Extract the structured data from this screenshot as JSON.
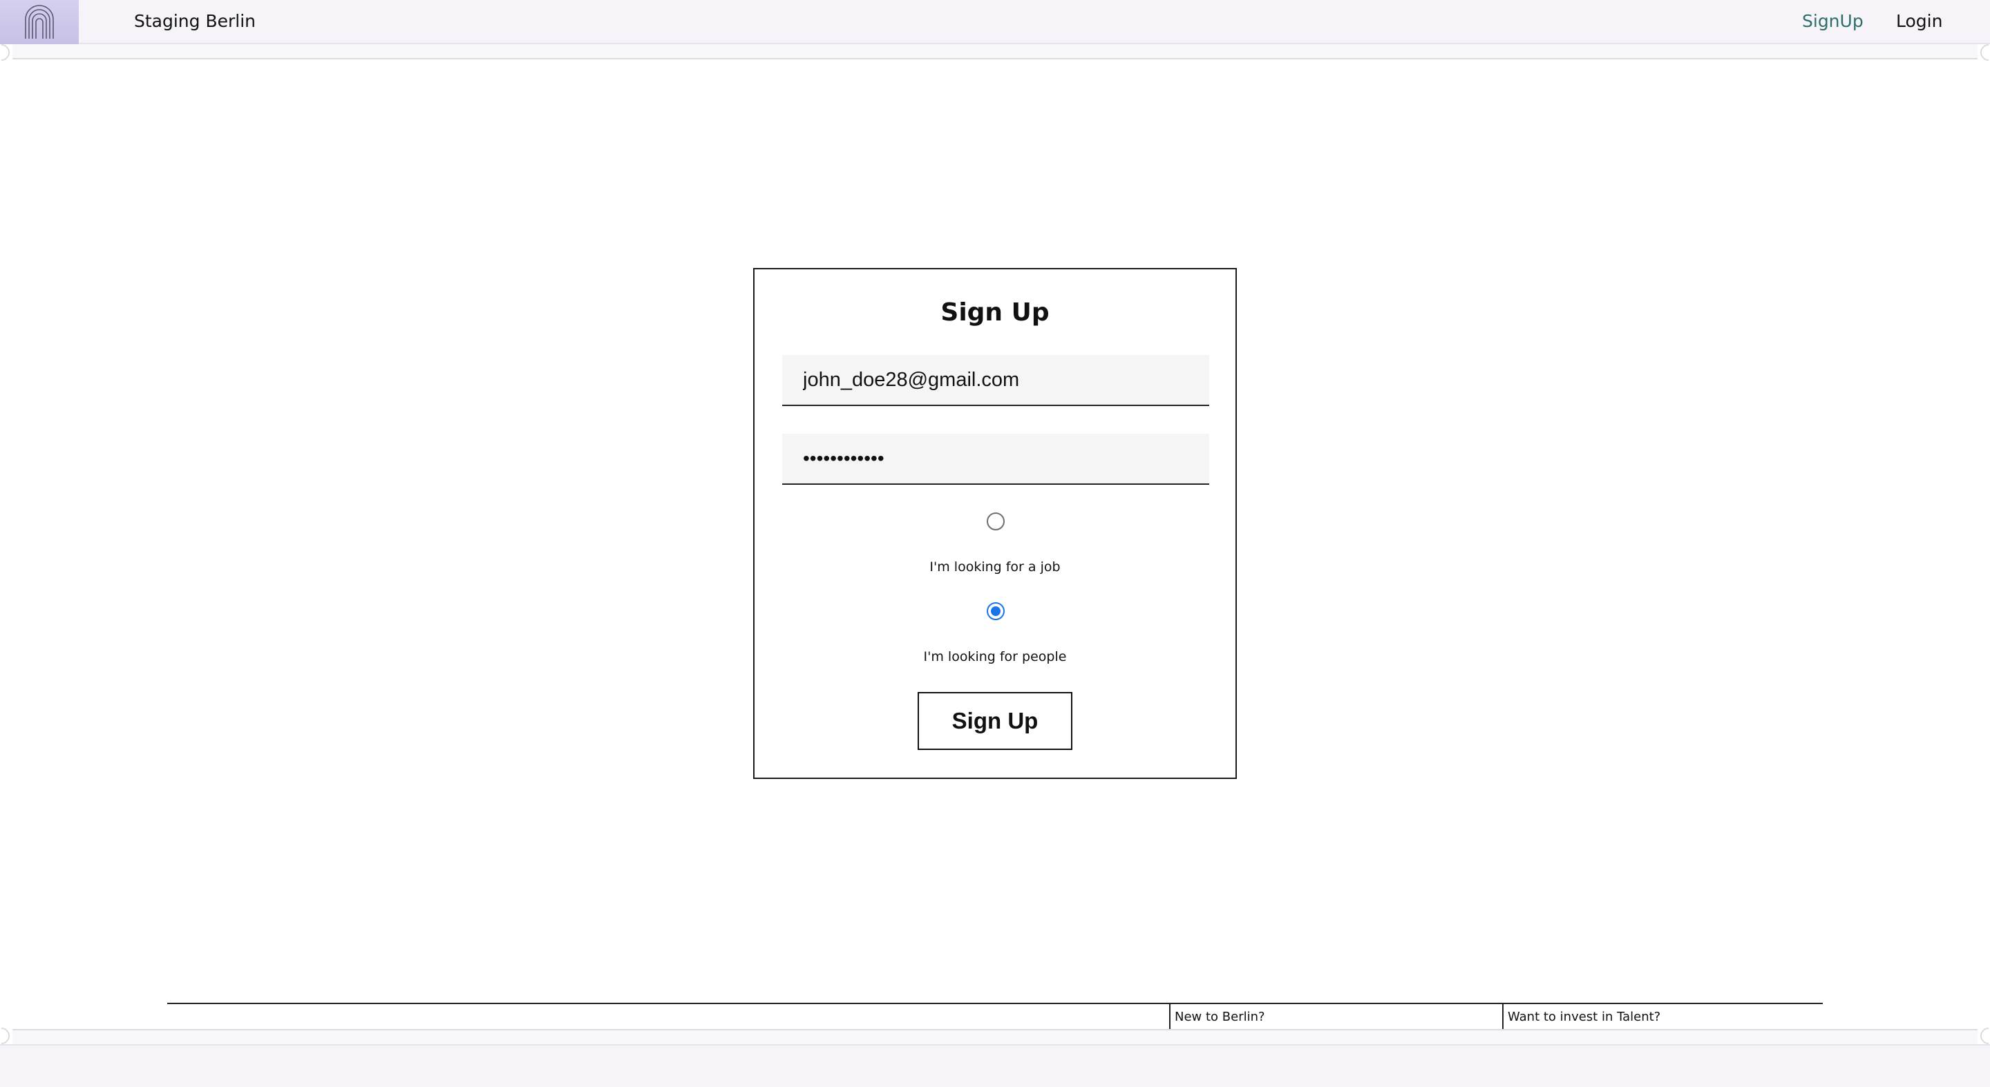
{
  "header": {
    "logo_icon": "arched-doorway-logo-icon",
    "brand": "Staging Berlin",
    "nav": {
      "signup": "SignUp",
      "login": "Login"
    },
    "colors": {
      "signup_link": "#2c6f6a",
      "logo_background": "#c6c1e6"
    }
  },
  "signup_form": {
    "title": "Sign Up",
    "email_value": "john_doe28@gmail.com",
    "password_masked": "••••••••••••",
    "options": [
      {
        "label": "I'm looking for a job",
        "selected": false
      },
      {
        "label": "I'm looking for people",
        "selected": true
      }
    ],
    "submit_label": "Sign Up",
    "colors": {
      "radio_selected": "#1a73e8"
    }
  },
  "footer": {
    "links": [
      "New to Berlin?",
      "Want to invest in Talent?"
    ]
  }
}
